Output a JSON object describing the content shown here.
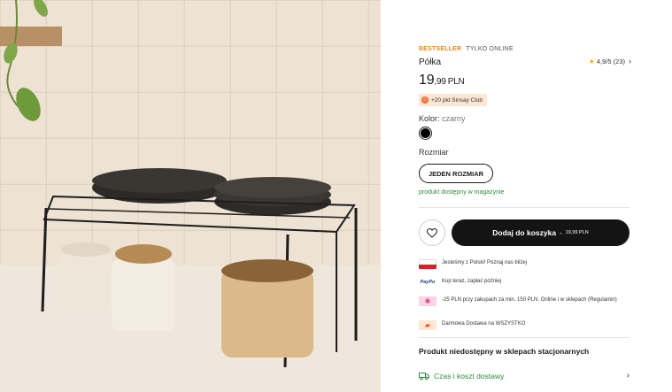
{
  "photo": {
    "alt_icon": "product-photo-icon"
  },
  "product": {
    "badge_bestseller": "BESTSELLER",
    "badge_online": "TYLKO ONLINE",
    "title": "Półka",
    "rating": "4,9/5 (23)",
    "price_int": "19",
    "price_dec": ",99",
    "currency": "PLN",
    "club_points": "+20 pkt Sinsay Club",
    "color_label": "Kolor:",
    "color_value": "czarny",
    "size_label": "Rozmiar",
    "size_option": "JEDEN ROZMIAR",
    "stock": "produkt dostępny w magazynie"
  },
  "actions": {
    "cart_label": "Dodaj do koszyka",
    "cart_sep": "-",
    "cart_price": "19,99 PLN"
  },
  "info": [
    {
      "icon": "flag-icon",
      "text": "Jesteśmy z Polski! Poznaj nas bliżej"
    },
    {
      "icon": "paypal-icon",
      "icon_text": "PayPo",
      "text": "Kup teraz, zapłać później"
    },
    {
      "icon": "tag-icon",
      "text": "-25 PLN przy zakupach za min. 150 PLN. Online i w sklepach (Regulamin)"
    },
    {
      "icon": "truck-icon",
      "text": "Darmowa Dostawa na WSZYSTKO"
    }
  ],
  "store": {
    "unavailable": "Produkt niedostępny w sklepach stacjonarnych",
    "delivery_label": "Czas i koszt dostawy"
  },
  "colors": {
    "accent_orange": "#e08a1e",
    "stock_green": "#2e8b3a",
    "cart_bg": "#141414"
  }
}
